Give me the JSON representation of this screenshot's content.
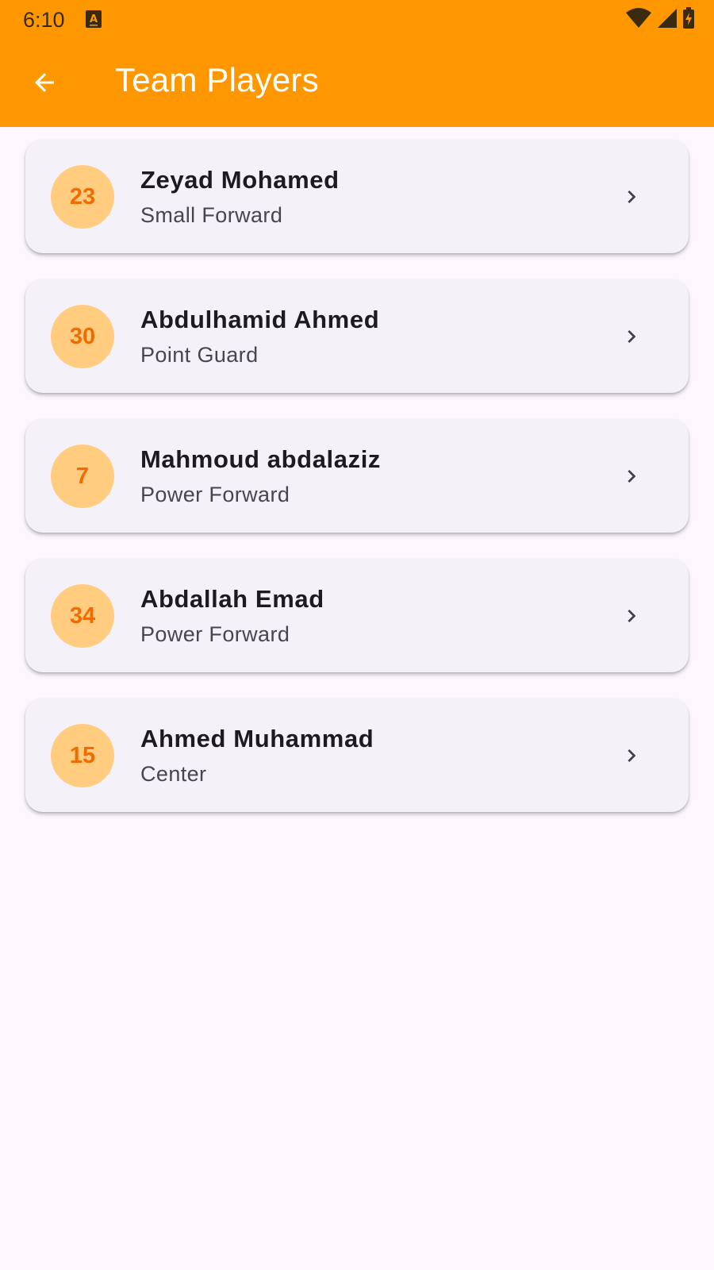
{
  "status_bar": {
    "time": "6:10",
    "app_icon_letter": "A"
  },
  "app_bar": {
    "title": "Team Players",
    "color": "#FF9800"
  },
  "colors": {
    "avatar_bg": "#FFCC80",
    "avatar_text": "#EF6C00",
    "card_bg": "#F5F1F8",
    "page_bg": "#FDF7FD"
  },
  "players": [
    {
      "number": "23",
      "name": "Zeyad Mohamed",
      "position": "Small Forward"
    },
    {
      "number": "30",
      "name": "Abdulhamid Ahmed",
      "position": "Point Guard"
    },
    {
      "number": "7",
      "name": "Mahmoud abdalaziz",
      "position": "Power Forward"
    },
    {
      "number": "34",
      "name": "Abdallah Emad",
      "position": "Power Forward"
    },
    {
      "number": "15",
      "name": "Ahmed Muhammad",
      "position": "Center"
    }
  ],
  "icons": {
    "back": "arrow-back-icon",
    "row_action": "chevron-right-icon",
    "wifi": "wifi-icon",
    "signal": "signal-icon",
    "battery": "battery-charging-icon"
  }
}
